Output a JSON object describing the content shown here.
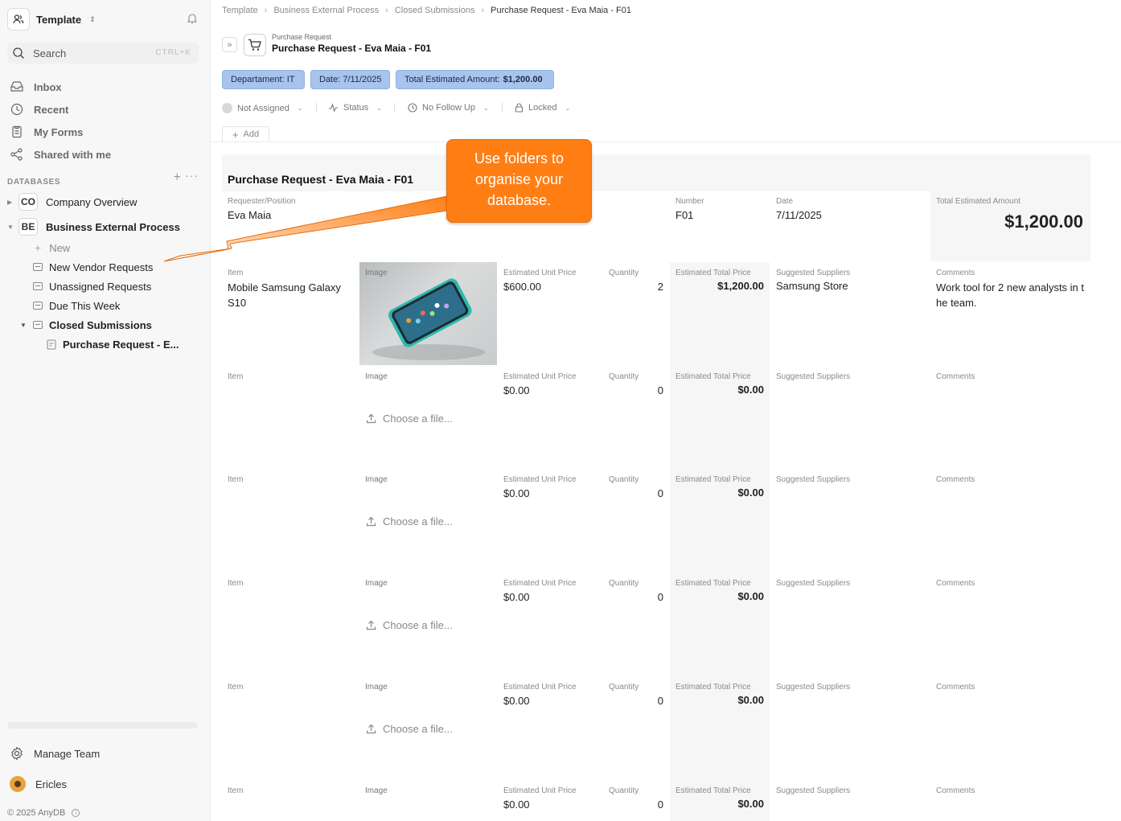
{
  "sidebar": {
    "workspace": "Template",
    "search": {
      "placeholder": "Search",
      "shortcut": "CTRL+K"
    },
    "nav": [
      {
        "label": "Inbox",
        "icon": "inbox-icon"
      },
      {
        "label": "Recent",
        "icon": "clock-icon"
      },
      {
        "label": "My Forms",
        "icon": "forms-icon"
      },
      {
        "label": "Shared with me",
        "icon": "share-icon"
      }
    ],
    "databases_title": "DATABASES",
    "databases": [
      {
        "badge": "CO",
        "label": "Company Overview",
        "expanded": false
      },
      {
        "badge": "BE",
        "label": "Business External Process",
        "expanded": true
      }
    ],
    "new_label": "New",
    "folders": [
      "New Vendor Requests",
      "Unassigned Requests",
      "Due This Week",
      "Closed Submissions"
    ],
    "closed_child": "Purchase Request - E...",
    "manage_team": "Manage Team",
    "user": "Ericles",
    "copyright": "© 2025 AnyDB"
  },
  "breadcrumbs": [
    "Template",
    "Business External Process",
    "Closed Submissions",
    "Purchase Request - Eva Maia - F01"
  ],
  "header": {
    "kicker": "Purchase Request",
    "title": "Purchase Request - Eva Maia - F01"
  },
  "tags": [
    {
      "label": "Departament:",
      "value": "IT"
    },
    {
      "label": "Date:",
      "value": "7/11/2025"
    },
    {
      "label": "Total Estimated Amount:",
      "value": "$1,200.00"
    }
  ],
  "meta": {
    "assigned": "Not Assigned",
    "status": "Status",
    "follow_up": "No Follow Up",
    "lock": "Locked"
  },
  "add_label": "Add",
  "form": {
    "title": "Purchase Request - Eva Maia - F01",
    "requester_label": "Requester/Position",
    "requester": "Eva Maia",
    "number_label": "Number",
    "number": "F01",
    "date_label": "Date",
    "date": "7/11/2025",
    "total_label": "Total Estimated Amount",
    "total": "$1,200.00"
  },
  "columns": {
    "item": "Item",
    "image": "Image",
    "unit_price": "Estimated Unit Price",
    "quantity": "Quantity",
    "total_price": "Estimated Total Price",
    "suppliers": "Suppliers",
    "suppliers_prefix": "Suggested",
    "comments": "Comments"
  },
  "rows": [
    {
      "item": "Mobile Samsung Galaxy S10",
      "unit_price": "$600.00",
      "quantity": "2",
      "total_price": "$1,200.00",
      "suppliers": "Samsung Store",
      "comments": "Work tool for 2 new analysts in the team.",
      "has_image": true
    },
    {
      "item": "",
      "unit_price": "$0.00",
      "quantity": "0",
      "total_price": "$0.00",
      "suppliers": "",
      "comments": "",
      "has_image": false
    },
    {
      "item": "",
      "unit_price": "$0.00",
      "quantity": "0",
      "total_price": "$0.00",
      "suppliers": "",
      "comments": "",
      "has_image": false
    },
    {
      "item": "",
      "unit_price": "$0.00",
      "quantity": "0",
      "total_price": "$0.00",
      "suppliers": "",
      "comments": "",
      "has_image": false
    },
    {
      "item": "",
      "unit_price": "$0.00",
      "quantity": "0",
      "total_price": "$0.00",
      "suppliers": "",
      "comments": "",
      "has_image": false
    },
    {
      "item": "",
      "unit_price": "$0.00",
      "quantity": "0",
      "total_price": "$0.00",
      "suppliers": "",
      "comments": "",
      "has_image": false
    }
  ],
  "choose_file": "Choose a file...",
  "callout": "Use folders to organise your database.",
  "colors": {
    "accent_tag": "#a8c3ec",
    "callout": "#ff7e14"
  }
}
